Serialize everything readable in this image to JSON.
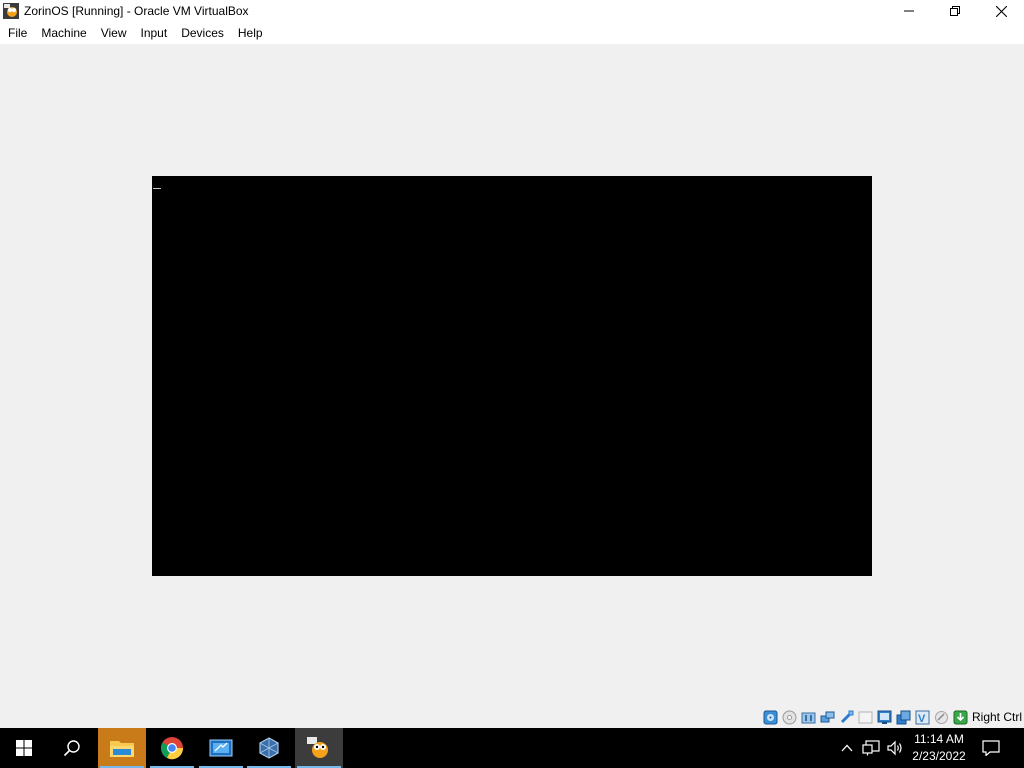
{
  "window": {
    "title": "ZorinOS [Running] - Oracle VM VirtualBox",
    "icon": "virtualbox-vm-icon"
  },
  "menu": {
    "items": [
      "File",
      "Machine",
      "View",
      "Input",
      "Devices",
      "Help"
    ]
  },
  "vm": {
    "screen_color": "#000000"
  },
  "statusbar": {
    "icons": [
      "hard-disk-icon",
      "optical-drive-icon",
      "audio-icon",
      "network-icon",
      "usb-icon",
      "shared-folders-icon",
      "display-icon",
      "video-capture-icon",
      "cpu-icon",
      "mouse-integration-icon",
      "keyboard-icon"
    ],
    "host_key": "Right Ctrl"
  },
  "taskbar": {
    "apps": [
      "file-explorer-icon",
      "chrome-icon",
      "remote-desktop-icon",
      "virtualbox-icon",
      "virtualbox-vm-window-icon"
    ],
    "clock": {
      "time": "11:14 AM",
      "date": "2/23/2022"
    }
  },
  "colors": {
    "taskbar_bg": "#000000",
    "file_explorer_active": "#c97a19",
    "accent": "#76b9ed"
  }
}
